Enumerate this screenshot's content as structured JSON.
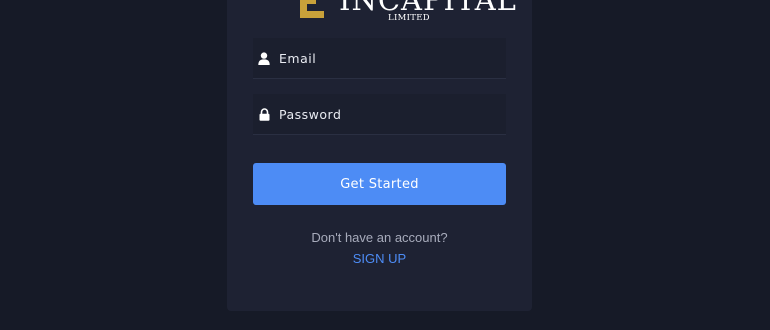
{
  "logo": {
    "name": "INCAPITAL",
    "subtitle": "LIMITED",
    "accent_color": "#c8a13a"
  },
  "login": {
    "email_placeholder": "Email",
    "password_placeholder": "Password",
    "email_icon": "user-icon",
    "password_icon": "lock-icon",
    "submit_label": "Get Started"
  },
  "footer": {
    "prompt": "Don't have an account?",
    "signup_label": "SIGN UP"
  },
  "colors": {
    "background": "#161a27",
    "card": "#1e2233",
    "primary": "#4d8cf5"
  }
}
